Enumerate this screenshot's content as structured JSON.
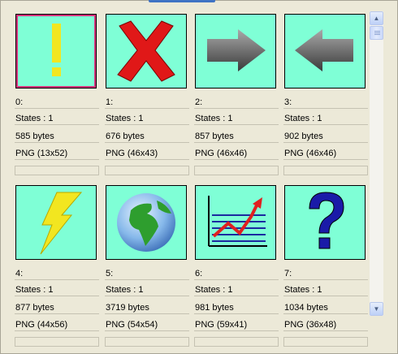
{
  "tiles": [
    {
      "index": "0:",
      "states": "States : 1",
      "size": "585 bytes",
      "format": "PNG (13x52)",
      "icon": "exclamation-icon",
      "selected": true
    },
    {
      "index": "1:",
      "states": "States : 1",
      "size": "676 bytes",
      "format": "PNG (46x43)",
      "icon": "red-x-icon",
      "selected": false
    },
    {
      "index": "2:",
      "states": "States : 1",
      "size": "857 bytes",
      "format": "PNG (46x46)",
      "icon": "arrow-right-icon",
      "selected": false
    },
    {
      "index": "3:",
      "states": "States : 1",
      "size": "902 bytes",
      "format": "PNG (46x46)",
      "icon": "arrow-left-icon",
      "selected": false
    },
    {
      "index": "4:",
      "states": "States : 1",
      "size": "877 bytes",
      "format": "PNG (44x56)",
      "icon": "lightning-icon",
      "selected": false
    },
    {
      "index": "5:",
      "states": "States : 1",
      "size": "3719 bytes",
      "format": "PNG (54x54)",
      "icon": "globe-icon",
      "selected": false
    },
    {
      "index": "6:",
      "states": "States : 1",
      "size": "981 bytes",
      "format": "PNG (59x41)",
      "icon": "chart-icon",
      "selected": false
    },
    {
      "index": "7:",
      "states": "States : 1",
      "size": "1034 bytes",
      "format": "PNG (36x48)",
      "icon": "question-icon",
      "selected": false
    }
  ],
  "colors": {
    "thumb_bg": "#7fffd6",
    "selection": "#d4317a"
  }
}
